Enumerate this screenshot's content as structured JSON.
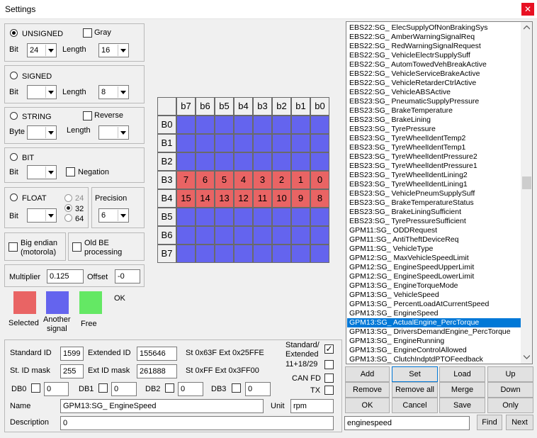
{
  "window": {
    "title": "Settings",
    "close_glyph": "✕"
  },
  "unsigned": {
    "label": "UNSIGNED",
    "gray_label": "Gray",
    "bit_label": "Bit",
    "bit_value": "24",
    "length_label": "Length",
    "length_value": "16"
  },
  "signed": {
    "label": "SIGNED",
    "bit_label": "Bit",
    "bit_value": "",
    "length_label": "Length",
    "length_value": "8"
  },
  "string": {
    "label": "STRING",
    "reverse_label": "Reverse",
    "byte_label": "Byte",
    "byte_value": "",
    "length_label": "Length",
    "length_value": ""
  },
  "bit": {
    "label": "BIT",
    "bit_label": "Bit",
    "bit_value": "",
    "negation_label": "Negation"
  },
  "float": {
    "label": "FLOAT",
    "bit_label": "Bit",
    "bit_value": "",
    "opt24": "24",
    "opt32": "32",
    "opt64": "64",
    "precision_label": "Precision",
    "precision_value": "6"
  },
  "endian": {
    "big_endian_line1": "Big endian",
    "big_endian_line2": "(motorola)",
    "old_be_line1": "Old BE",
    "old_be_line2": "processing"
  },
  "scaling": {
    "multiplier_label": "Multiplier",
    "multiplier_value": "0.125",
    "offset_label": "Offset",
    "offset_value": "-0"
  },
  "legend": {
    "selected_label": "Selected",
    "another_line1": "Another",
    "another_line2": "signal",
    "free_label": "Free",
    "ok_label": "OK",
    "colors": {
      "selected": "#e96464",
      "another": "#6464ee",
      "free": "#64e864"
    }
  },
  "grid": {
    "col_headers": [
      "b7",
      "b6",
      "b5",
      "b4",
      "b3",
      "b2",
      "b1",
      "b0"
    ],
    "row_headers": [
      "B0",
      "B1",
      "B2",
      "B3",
      "B4",
      "B5",
      "B6",
      "B7"
    ],
    "cells": [
      [
        "",
        "",
        "",
        "",
        "",
        "",
        "",
        ""
      ],
      [
        "",
        "",
        "",
        "",
        "",
        "",
        "",
        ""
      ],
      [
        "",
        "",
        "",
        "",
        "",
        "",
        "",
        ""
      ],
      [
        "7",
        "6",
        "5",
        "4",
        "3",
        "2",
        "1",
        "0"
      ],
      [
        "15",
        "14",
        "13",
        "12",
        "11",
        "10",
        "9",
        "8"
      ],
      [
        "",
        "",
        "",
        "",
        "",
        "",
        "",
        ""
      ],
      [
        "",
        "",
        "",
        "",
        "",
        "",
        "",
        ""
      ],
      [
        "",
        "",
        "",
        "",
        "",
        "",
        "",
        ""
      ]
    ],
    "states": [
      [
        "another",
        "another",
        "another",
        "another",
        "another",
        "another",
        "another",
        "another"
      ],
      [
        "another",
        "another",
        "another",
        "another",
        "another",
        "another",
        "another",
        "another"
      ],
      [
        "another",
        "another",
        "another",
        "another",
        "another",
        "another",
        "another",
        "another"
      ],
      [
        "selected",
        "selected",
        "selected",
        "selected",
        "selected",
        "selected",
        "selected",
        "selected"
      ],
      [
        "selected",
        "selected",
        "selected",
        "selected",
        "selected",
        "selected",
        "selected",
        "selected"
      ],
      [
        "another",
        "another",
        "another",
        "another",
        "another",
        "another",
        "another",
        "another"
      ],
      [
        "another",
        "another",
        "another",
        "another",
        "another",
        "another",
        "another",
        "another"
      ],
      [
        "another",
        "another",
        "another",
        "another",
        "another",
        "another",
        "another",
        "another"
      ]
    ]
  },
  "ids": {
    "standard_id_label": "Standard ID",
    "standard_id_value": "1599",
    "extended_id_label": "Extended ID",
    "extended_id_value": "155646",
    "st_ext_text": "St 0x63F Ext 0x25FFE",
    "st_mask_label": "St. ID mask",
    "st_mask_value": "255",
    "ext_mask_label": "Ext ID mask",
    "ext_mask_value": "261888",
    "mask_text": "St 0xFF Ext 0x3FF00",
    "std_ext_line1": "Standard/",
    "std_ext_line2": "Extended",
    "mode_1118": "11+18/29",
    "can_fd_label": "CAN FD",
    "tx_label": "TX"
  },
  "db": [
    {
      "label": "DB0",
      "value": "0"
    },
    {
      "label": "DB1",
      "value": "0"
    },
    {
      "label": "DB2",
      "value": "0"
    },
    {
      "label": "DB3",
      "value": "0"
    }
  ],
  "name": {
    "label": "Name",
    "value": "GPM13:SG_ EngineSpeed",
    "unit_label": "Unit",
    "unit_value": "rpm"
  },
  "description": {
    "label": "Description",
    "value": "0"
  },
  "signal_list": {
    "selected_index": 32,
    "items": [
      "EBS22:SG_ ElecSupplyOfNonBrakingSys",
      "EBS22:SG_ AmberWarningSignalReq",
      "EBS22:SG_ RedWarningSignalRequest",
      "EBS22:SG_ VehicleElectrSupplySuff",
      "EBS22:SG_ AutomTowedVehBreakActive",
      "EBS22:SG_ VehicleServiceBrakeActive",
      "EBS22:SG_ VehicleRetarderCtrlActive",
      "EBS22:SG_ VehicleABSActive",
      "EBS23:SG_ PneumaticSupplyPressure",
      "EBS23:SG_ BrakeTemperature",
      "EBS23:SG_ BrakeLining",
      "EBS23:SG_ TyrePressure",
      "EBS23:SG_ TyreWheelIdentTemp2",
      "EBS23:SG_ TyreWheelIdentTemp1",
      "EBS23:SG_ TyreWheelIdentPressure2",
      "EBS23:SG_ TyreWheelIdentPressure1",
      "EBS23:SG_ TyreWheelIdentLining2",
      "EBS23:SG_ TyreWheelIdentLining1",
      "EBS23:SG_ VehiclePneumSupplySuff",
      "EBS23:SG_ BrakeTemperatureStatus",
      "EBS23:SG_ BrakeLiningSufficient",
      "EBS23:SG_ TyrePressureSufficient",
      "GPM11:SG_ ODDRequest",
      "GPM11:SG_ AntiTheftDeviceReq",
      "GPM11:SG_ VehicleType",
      "GPM12:SG_ MaxVehicleSpeedLimit",
      "GPM12:SG_ EngineSpeedUpperLimit",
      "GPM12:SG_ EngineSpeedLowerLimit",
      "GPM13:SG_ EngineTorqueMode",
      "GPM13:SG_ VehicleSpeed",
      "GPM13:SG_ PercentLoadAtCurrentSpeed",
      "GPM13:SG_ EngineSpeed",
      "GPM13:SG_ ActualEngine_PercTorque",
      "GPM13:SG_ DriversDemandEngine_PercTorque",
      "GPM13:SG_ EngineRunning",
      "GPM13:SG_ EngineControlAllowed",
      "GPM13:SG_ ClutchIndptdPTOFeedback"
    ]
  },
  "buttons": {
    "add": "Add",
    "set": "Set",
    "load": "Load",
    "up": "Up",
    "remove": "Remove",
    "remove_all": "Remove all",
    "merge": "Merge",
    "down": "Down",
    "ok": "OK",
    "cancel": "Cancel",
    "save": "Save",
    "only": "Only",
    "find": "Find",
    "next": "Next"
  },
  "search": {
    "value": "enginespeed"
  }
}
